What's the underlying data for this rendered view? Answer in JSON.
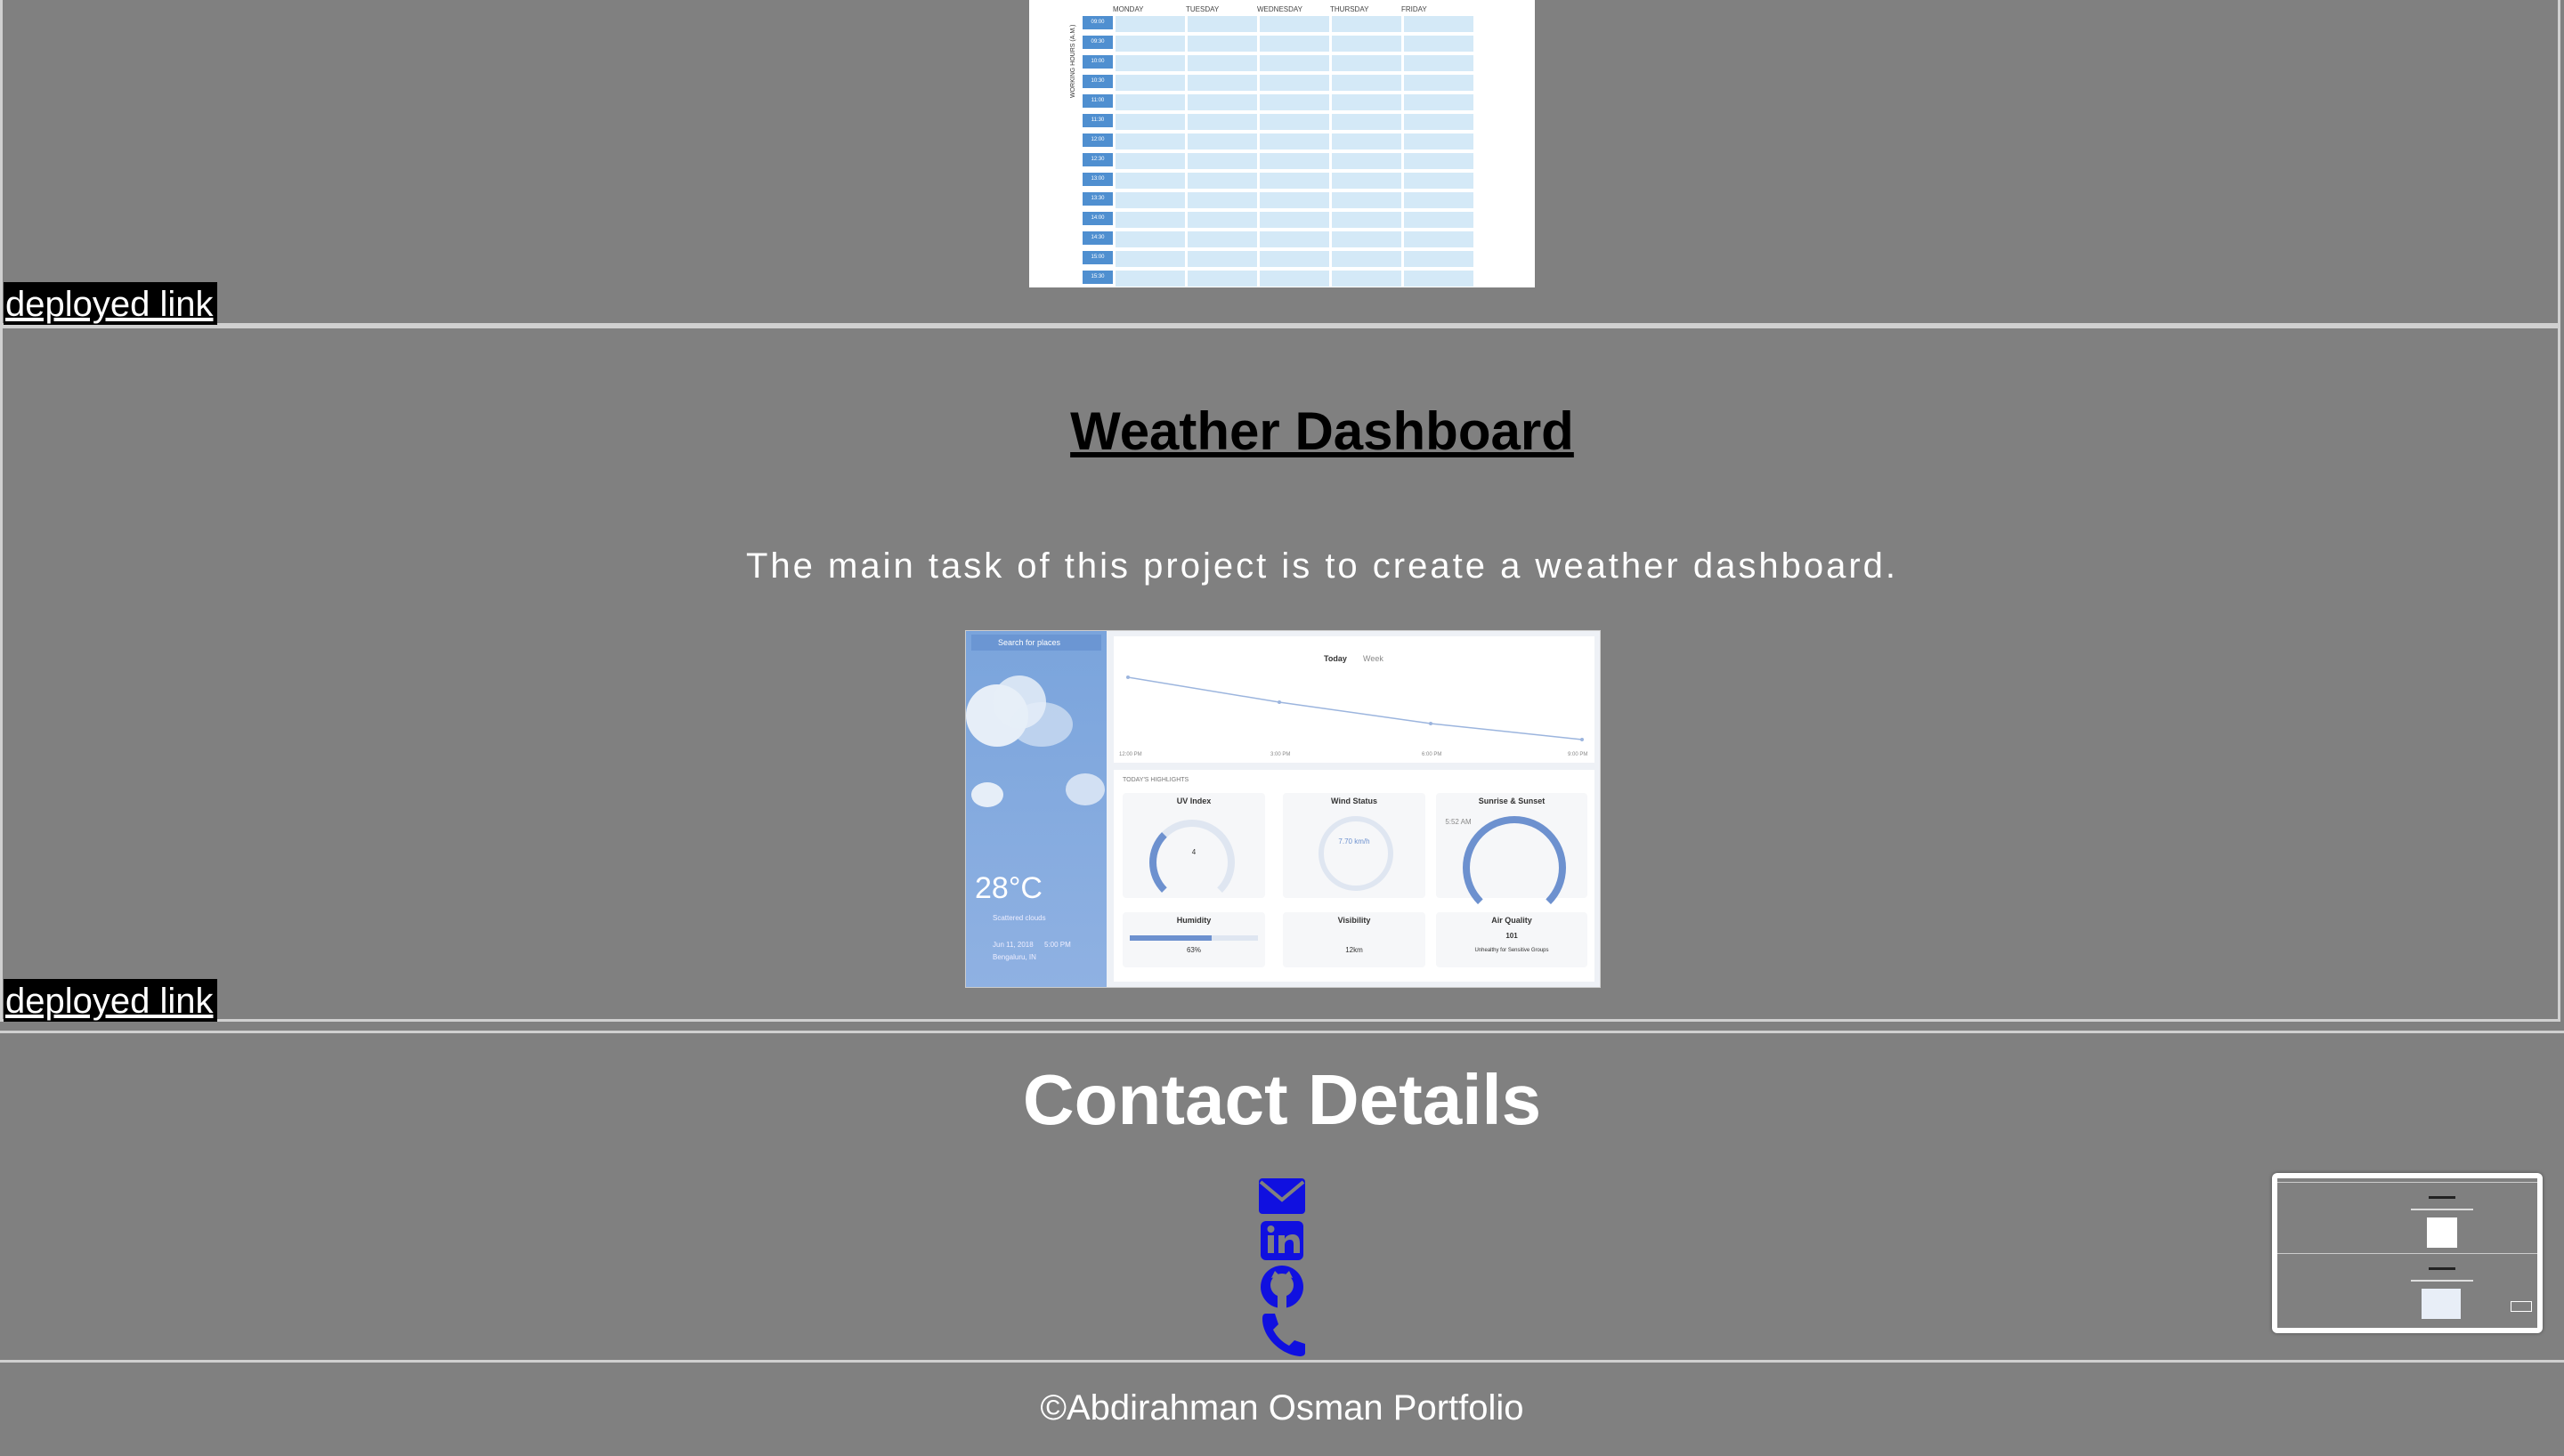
{
  "scheduler": {
    "days": [
      "MONDAY",
      "TUESDAY",
      "WEDNESDAY",
      "THURSDAY",
      "FRIDAY"
    ],
    "side_label": "WORKING HOURS (A.M.)",
    "times": [
      "09:00",
      "09:30",
      "10:00",
      "10:30",
      "11:00",
      "11:30",
      "12:00",
      "12:30",
      "13:00",
      "13:30",
      "14:00",
      "14:30",
      "15:00",
      "15:30"
    ]
  },
  "projects": [
    {
      "deployed_link": "deployed link"
    },
    {
      "title": "Weather Dashboard",
      "description": "The main task of this project is to create a weather dashboard.",
      "deployed_link": "deployed link"
    }
  ],
  "weather_preview": {
    "search": "Search for places",
    "temp": "28°C",
    "condition": "Scattered clouds",
    "date": "Jun 11, 2018",
    "time": "5:00 PM",
    "location": "Bengaluru, IN",
    "tabs": [
      "Today",
      "Week"
    ],
    "highlights_label": "TODAY'S HIGHLIGHTS",
    "chart_times": [
      "12:00 PM",
      "3:00 PM",
      "6:00 PM",
      "9:00 PM"
    ],
    "cards": [
      {
        "title": "UV Index",
        "value": "4"
      },
      {
        "title": "Wind Status",
        "value": "7.70 km/h"
      },
      {
        "title": "Sunrise & Sunset",
        "value": "5:52 AM"
      },
      {
        "title": "Humidity",
        "value": "63%"
      },
      {
        "title": "Visibility",
        "value": "12km"
      },
      {
        "title": "Air Quality",
        "value": "101"
      }
    ],
    "air_quality_note": "Unhealthy for Sensitive Groups"
  },
  "contact": {
    "title": "Contact Details",
    "icons": [
      "envelope-icon",
      "linkedin-icon",
      "github-icon",
      "phone-icon"
    ]
  },
  "footer": {
    "text": "©Abdirahman Osman Portfolio"
  },
  "colors": {
    "background": "#808080",
    "icon": "#1010e0",
    "link_bg": "#000000"
  }
}
